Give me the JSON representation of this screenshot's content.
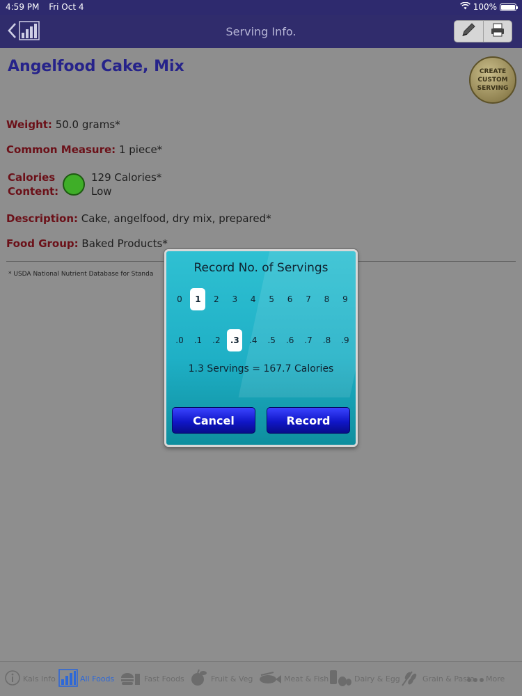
{
  "status_bar": {
    "time": "4:59 PM",
    "date": "Fri Oct 4",
    "battery": "100%"
  },
  "nav": {
    "title": "Serving Info."
  },
  "food": {
    "name": "Angelfood Cake, Mix",
    "custom_serving": "CREATE CUSTOM SERVING",
    "weight_label": "Weight:",
    "weight_value": "50.0 grams*",
    "measure_label": "Common Measure:",
    "measure_value": "1 piece*",
    "calories_label_1": "Calories",
    "calories_label_2": "Content:",
    "calories_value": "129 Calories*",
    "calories_level": "Low",
    "description_label": "Description:",
    "description_value": "Cake, angelfood, dry mix, prepared*",
    "group_label": "Food Group:",
    "group_value": "Baked Products*",
    "footnote": "* USDA National Nutrient Database for Standa"
  },
  "dialog": {
    "title": "Record No. of Servings",
    "whole_digits": [
      "0",
      "1",
      "2",
      "3",
      "4",
      "5",
      "6",
      "7",
      "8",
      "9"
    ],
    "whole_selected": "1",
    "fraction_digits": [
      ".0",
      ".1",
      ".2",
      ".3",
      ".4",
      ".5",
      ".6",
      ".7",
      ".8",
      ".9"
    ],
    "fraction_selected": ".3",
    "summary": "1.3 Servings = 167.7 Calories",
    "cancel_label": "Cancel",
    "record_label": "Record"
  },
  "tabs": [
    {
      "label": "Kals Info",
      "icon": "info-icon",
      "active": false
    },
    {
      "label": "All Foods",
      "icon": "bar-chart-icon",
      "active": true
    },
    {
      "label": "Fast Foods",
      "icon": "fast-food-icon",
      "active": false
    },
    {
      "label": "Fruit & Veg",
      "icon": "fruit-icon",
      "active": false
    },
    {
      "label": "Meat & Fish",
      "icon": "fish-icon",
      "active": false
    },
    {
      "label": "Dairy & Egg",
      "icon": "dairy-icon",
      "active": false
    },
    {
      "label": "Grain & Pasta",
      "icon": "grain-icon",
      "active": false
    },
    {
      "label": "More",
      "icon": "more-icon",
      "active": false
    }
  ]
}
